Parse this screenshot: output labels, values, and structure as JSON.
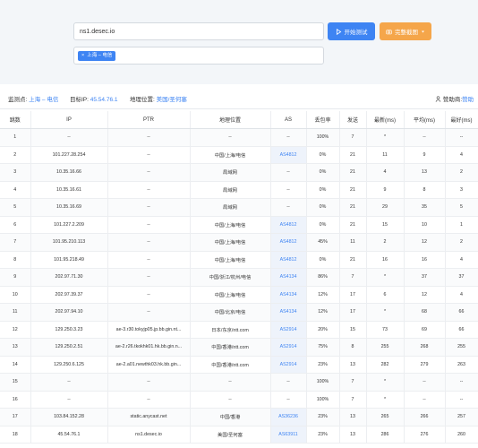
{
  "form": {
    "host_value": "ns1.desec.io",
    "start_label": "开始测试",
    "screenshot_label": "完整截图",
    "tag_label": "上海 – 电信",
    "tag_close": "×"
  },
  "info": {
    "monitor_label": "监测点:",
    "monitor_value": "上海 – 电信",
    "target_label": "目标IP:",
    "target_value": "45.54.76.1",
    "geo_label": "地理位置:",
    "geo_value": "美国/圣何塞",
    "sponsor_label": "赞助商:",
    "sponsor_value": "赞助"
  },
  "table": {
    "headers": [
      "跳数",
      "IP",
      "PTR",
      "地理位置",
      "AS",
      "丢包率",
      "发送",
      "最新(ms)",
      "平均(ms)",
      "最好(ms)"
    ],
    "rows": [
      [
        "1",
        "--",
        "--",
        "--",
        "--",
        "100%",
        "7",
        "*",
        "--",
        "--"
      ],
      [
        "2",
        "101.227.28.254",
        "--",
        "中国/上海/电信",
        "AS4812",
        "0%",
        "21",
        "11",
        "9",
        "4"
      ],
      [
        "3",
        "10.35.16.66",
        "--",
        "局域网",
        "--",
        "0%",
        "21",
        "4",
        "13",
        "2"
      ],
      [
        "4",
        "10.35.16.61",
        "--",
        "局域网",
        "--",
        "0%",
        "21",
        "9",
        "8",
        "3"
      ],
      [
        "5",
        "10.35.16.69",
        "--",
        "局域网",
        "--",
        "0%",
        "21",
        "29",
        "35",
        "5"
      ],
      [
        "6",
        "101.227.2.209",
        "--",
        "中国/上海/电信",
        "AS4812",
        "0%",
        "21",
        "15",
        "10",
        "1"
      ],
      [
        "7",
        "101.95.210.113",
        "--",
        "中国/上海/电信",
        "AS4812",
        "45%",
        "11",
        "2",
        "12",
        "2"
      ],
      [
        "8",
        "101.95.218.49",
        "--",
        "中国/上海/电信",
        "AS4812",
        "0%",
        "21",
        "16",
        "16",
        "4"
      ],
      [
        "9",
        "202.97.71.30",
        "--",
        "中国/浙江/杭州/电信",
        "AS4134",
        "86%",
        "7",
        "*",
        "37",
        "37"
      ],
      [
        "10",
        "202.97.39.37",
        "--",
        "中国/上海/电信",
        "AS4134",
        "12%",
        "17",
        "6",
        "12",
        "4"
      ],
      [
        "11",
        "202.97.94.10",
        "--",
        "中国/北京/电信",
        "AS4134",
        "12%",
        "17",
        "*",
        "68",
        "66"
      ],
      [
        "12",
        "129.250.3.23",
        "ae-3.r30.tokyjp05.jp.bb.gin.nt...",
        "日本/东京/ntt.com",
        "AS2914",
        "20%",
        "15",
        "73",
        "69",
        "66"
      ],
      [
        "13",
        "129.250.2.51",
        "ae-2.r26.tkokhk01.hk.bb.gin.n...",
        "中国/香港/ntt.com",
        "AS2914",
        "75%",
        "8",
        "255",
        "268",
        "255"
      ],
      [
        "14",
        "129.250.6.125",
        "ae-2.a01.newthk03.hk.bb.gin...",
        "中国/香港/ntt.com",
        "AS2914",
        "23%",
        "13",
        "282",
        "279",
        "263"
      ],
      [
        "15",
        "--",
        "--",
        "--",
        "--",
        "100%",
        "7",
        "*",
        "--",
        "--"
      ],
      [
        "16",
        "--",
        "--",
        "--",
        "--",
        "100%",
        "7",
        "*",
        "--",
        "--"
      ],
      [
        "17",
        "103.84.152.28",
        "static.anycast.net",
        "中国/香港",
        "AS36236",
        "23%",
        "13",
        "265",
        "266",
        "257"
      ],
      [
        "18",
        "45.54.76.1",
        "ns1.desec.io",
        "美国/圣何塞",
        "AS63911",
        "23%",
        "13",
        "286",
        "276",
        "260"
      ]
    ]
  }
}
